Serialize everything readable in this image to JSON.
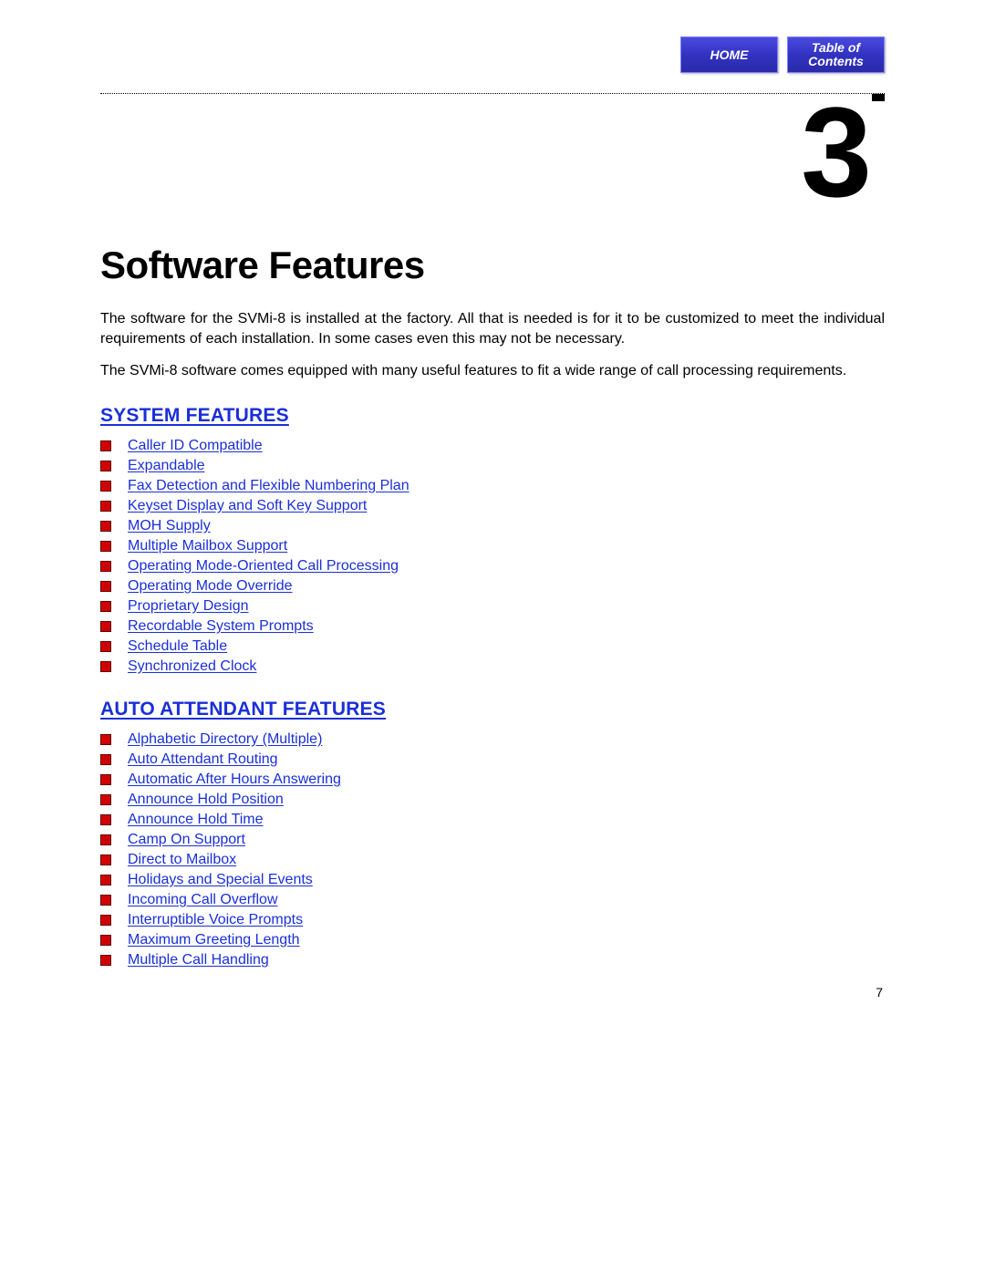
{
  "nav": {
    "home": "HOME",
    "toc_line1": "Table of",
    "toc_line2": "Contents"
  },
  "chapter_number": "3",
  "title": "Software Features",
  "paragraphs": [
    "The software for the SVMi-8 is installed at the factory. All that is needed is for it to be customized to meet the individual requirements of each installation. In some cases even this may not be necessary.",
    "The SVMi-8 software comes equipped with many useful features to fit a wide range of call processing requirements."
  ],
  "sections": [
    {
      "heading": "SYSTEM FEATURES",
      "items": [
        "Caller ID Compatible",
        "Expandable",
        "Fax Detection and Flexible Numbering Plan",
        "Keyset Display and Soft Key Support",
        "MOH Supply",
        "Multiple Mailbox Support",
        "Operating Mode-Oriented Call Processing",
        "Operating Mode Override",
        "Proprietary Design",
        "Recordable System Prompts",
        "Schedule Table",
        "Synchronized Clock"
      ]
    },
    {
      "heading": "AUTO ATTENDANT FEATURES",
      "items": [
        "Alphabetic Directory (Multiple)",
        "Auto Attendant Routing",
        "Automatic After Hours Answering",
        "Announce Hold Position",
        "Announce  Hold Time",
        "Camp On Support",
        "Direct to Mailbox",
        "Holidays and Special Events",
        "Incoming Call Overflow",
        "Interruptible Voice Prompts",
        "Maximum Greeting Length",
        "Multiple Call Handling"
      ]
    }
  ],
  "page_number": "7"
}
